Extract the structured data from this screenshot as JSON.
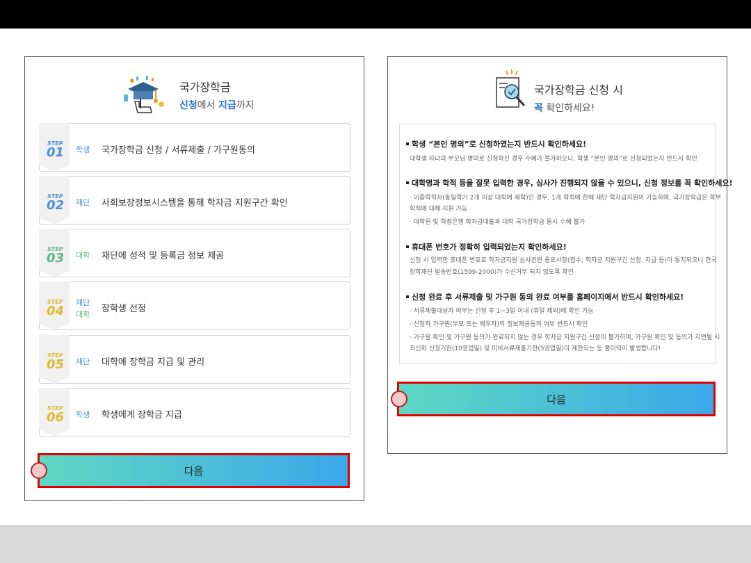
{
  "left_panel": {
    "title_line1": "국가장학금",
    "title_line2_part1": "신청",
    "title_line2_part2": "에서 ",
    "title_line2_part3": "지급",
    "title_line2_part4": "까지",
    "steps": [
      {
        "word": "STEP",
        "num": "01",
        "actor": "학생",
        "actor2": "",
        "text": "국가장학금 신청 / 서류제출 / 가구원동의",
        "color": "#4a8fd8"
      },
      {
        "word": "STEP",
        "num": "02",
        "actor": "재단",
        "actor2": "",
        "text": "사회보장정보시스템을 통해 학자금 지원구간 확인",
        "color": "#4a8fd8"
      },
      {
        "word": "STEP",
        "num": "03",
        "actor": "대학",
        "actor2": "",
        "text": "재단에 성적 및 등록금 정보 제공",
        "color": "#56b784"
      },
      {
        "word": "STEP",
        "num": "04",
        "actor": "재단",
        "actor2": "대학",
        "text": "장학생 선정",
        "color": "#e0b830"
      },
      {
        "word": "STEP",
        "num": "05",
        "actor": "재단",
        "actor2": "",
        "text": "대학에 장학금 지급 및 관리",
        "color": "#e0b830"
      },
      {
        "word": "STEP",
        "num": "06",
        "actor": "학생",
        "actor2": "",
        "text": "학생에게 장학금 지급",
        "color": "#e0b830"
      }
    ],
    "next_label": "다음"
  },
  "right_panel": {
    "title_line1": "국가장학금 신청 시",
    "title_line2_part1": "꼭",
    "title_line2_part2": " 확인하세요!",
    "sections": [
      {
        "heading": "학생 “본인 명의”로 신청하였는지 반드시 확인하세요!",
        "lines": [
          "대학생 자녀의 부모님 명의로 신청하신 경우 수혜가 불가하오니, 학생 “본인 명의”로 신청되었는지 반드시 확인"
        ]
      },
      {
        "heading": "대학명과 학적 등을 잘못 입력한 경우, 심사가 진행되지 않을 수 있으니, 신청 정보를 꼭 확인하세요!",
        "lines": [
          "· 이중학적자(동일학기 2개 이상 대학에 재학)인 경우, 1개 학적에 한해 재단 학자금지원이 가능하며, 국가장학금은 학부",
          "  학적에 대해 지원 가능",
          "· 대학원 및 학점은행 학자금대출과 대학 국가장학금 동시 수혜 불가"
        ]
      },
      {
        "heading": "휴대폰 번호가 정확히 입력되었는지 확인하세요!",
        "lines": [
          "신청 시 입력한 휴대폰 번호로 학자금지원 심사관련 중요사항(접수, 학자금 지원구간 산정, 지급 등)이 통지되오니 한국",
          "장학재단 발송번호(1599-2000)가 수신거부 되지 않도록 확인"
        ]
      },
      {
        "heading": "신청 완료 후 서류제출 및 가구원 동의 완료 여부를 홈페이지에서 반드시 확인하세요!",
        "lines": [
          "· 서류제출대상자 여부는 신청 후 1~3일 이내 (휴일 제외)에 확인 가능",
          "· 신청자 가구원(부모 또는 배우자)의 정보제공동의 여부 반드시 확인",
          "· 가구원 확인 및 가구원 동의가 완료되지 않는 경우 학자금 지원구간 산정이 불가하며, 가구원 확인 및 동의가 지연될 시",
          "  최신화 신청기한(10영업일) 및 미비서류제출기한(5영업일)이 제한되는 등 불이익이 발생합니다!"
        ]
      }
    ],
    "next_label": "다음"
  }
}
